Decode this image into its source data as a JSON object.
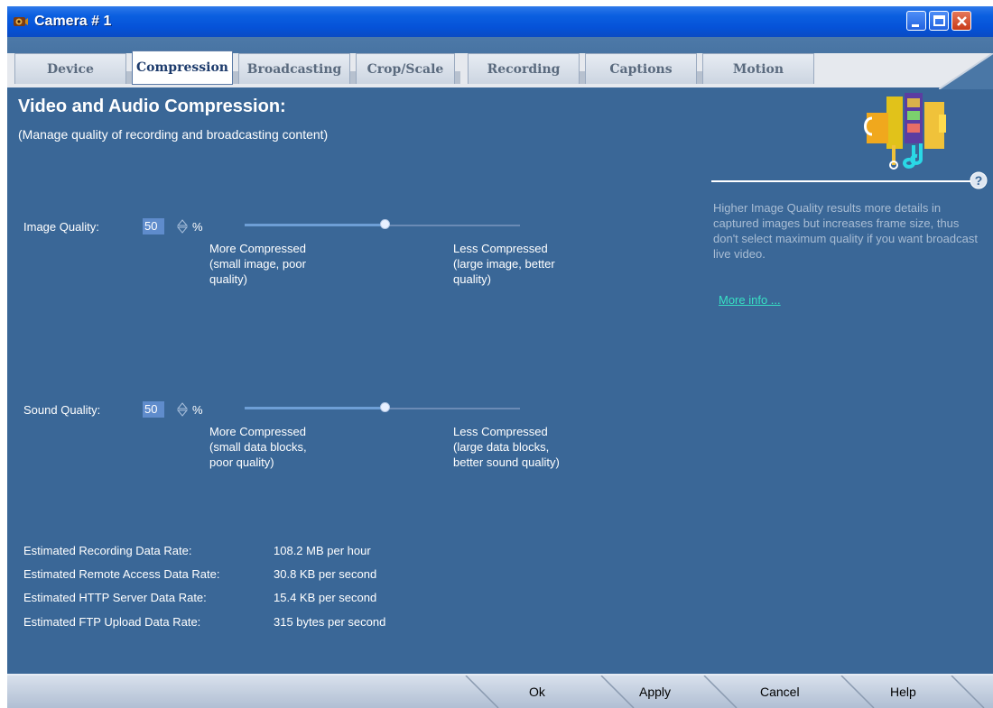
{
  "window": {
    "title": "Camera # 1"
  },
  "tabs": [
    {
      "label": "Device"
    },
    {
      "label": "Compression",
      "active": true
    },
    {
      "label": "Broadcasting"
    },
    {
      "label": "Crop/Scale"
    },
    {
      "label": "Recording"
    },
    {
      "label": "Captions"
    },
    {
      "label": "Motion"
    }
  ],
  "header": {
    "title": "Video and Audio Compression:",
    "subtitle": "(Manage quality of recording and broadcasting content)"
  },
  "image_quality": {
    "label": "Image Quality:",
    "value": "50",
    "unit": "%",
    "slider_level_percent": 50,
    "left_note": [
      "More Compressed",
      "(small image, poor",
      "quality)"
    ],
    "right_note": [
      "Less Compressed",
      "(large image, better",
      "quality)"
    ]
  },
  "sound_quality": {
    "label": "Sound Quality:",
    "value": "50",
    "unit": "%",
    "slider_level_percent": 50,
    "left_note": [
      "More Compressed",
      "(small data blocks,",
      "poor quality)"
    ],
    "right_note": [
      "Less Compressed",
      "(large data blocks,",
      "better sound quality)"
    ]
  },
  "help": {
    "text": "Higher Image Quality results more details in captured images but increases frame size, thus don't select maximum quality if you want broadcast live video.",
    "more_info": "More info ..."
  },
  "stats": [
    {
      "label": "Estimated Recording Data Rate:",
      "value": "108.2 MB per hour"
    },
    {
      "label": "Estimated Remote Access Data Rate:",
      "value": "30.8 KB per second"
    },
    {
      "label": "Estimated HTTP Server Data Rate:",
      "value": "15.4 KB per second"
    },
    {
      "label": "Estimated FTP Upload Data Rate:",
      "value": "315 bytes per second"
    }
  ],
  "buttons": {
    "ok": "Ok",
    "apply": "Apply",
    "cancel": "Cancel",
    "help": "Help"
  },
  "colors": {
    "panel_bg": "#3a6797",
    "link": "#38e0c4",
    "titlebar": "#0552d8"
  }
}
